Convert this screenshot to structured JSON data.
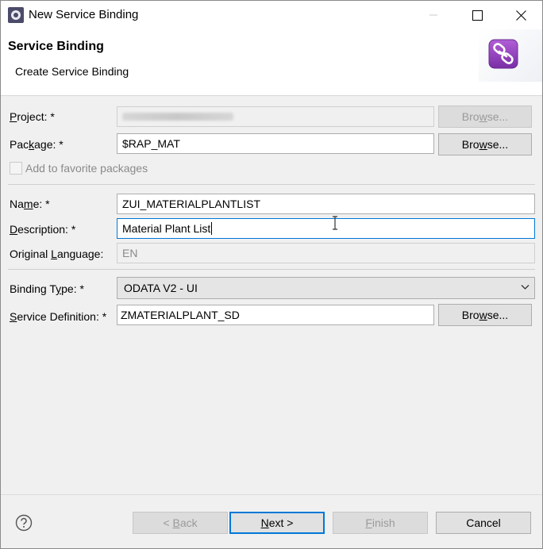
{
  "window": {
    "title": "New Service Binding",
    "icons": {
      "app": "eclipse-icon",
      "minimize": "minimize-icon",
      "maximize": "maximize-icon",
      "close": "close-icon"
    }
  },
  "banner": {
    "title": "Service Binding",
    "subtitle": "Create Service Binding",
    "icon": "service-binding-link-icon",
    "icon_color": "#8a3fb5"
  },
  "form": {
    "project": {
      "label_u": "P",
      "label_rest": "roject: *",
      "value": "",
      "browse": {
        "u": "w",
        "pre": "Bro",
        "post": "se..."
      }
    },
    "package": {
      "label_pre": "Pac",
      "label_u": "k",
      "label_rest": "age: *",
      "value": "$RAP_MAT",
      "browse": {
        "pre": "Bro",
        "u": "w",
        "post": "se..."
      }
    },
    "favorite": {
      "label": "Add to favorite packages"
    },
    "name": {
      "label_pre": "Na",
      "label_u": "m",
      "label_rest": "e: *",
      "value": "ZUI_MATERIALPLANTLIST"
    },
    "description": {
      "label_u": "D",
      "label_rest": "escription: *",
      "value": "Material Plant List"
    },
    "original_language": {
      "label_pre": "Original ",
      "label_u": "L",
      "label_rest": "anguage:",
      "value": "EN"
    },
    "binding_type": {
      "label_pre": "Binding T",
      "label_u": "y",
      "label_rest": "pe: *",
      "value": "ODATA V2 - UI"
    },
    "service_definition": {
      "label_u": "S",
      "label_rest": "ervice Definition: *",
      "value": "ZMATERIALPLANT_SD",
      "browse": {
        "pre": "Bro",
        "u": "w",
        "post": "se..."
      }
    }
  },
  "footer": {
    "help_icon": "help-icon",
    "back": {
      "pre": "< ",
      "u": "B",
      "post": "ack"
    },
    "next": {
      "u": "N",
      "post": "ext >"
    },
    "finish": {
      "u": "F",
      "post": "inish"
    },
    "cancel": "Cancel"
  }
}
